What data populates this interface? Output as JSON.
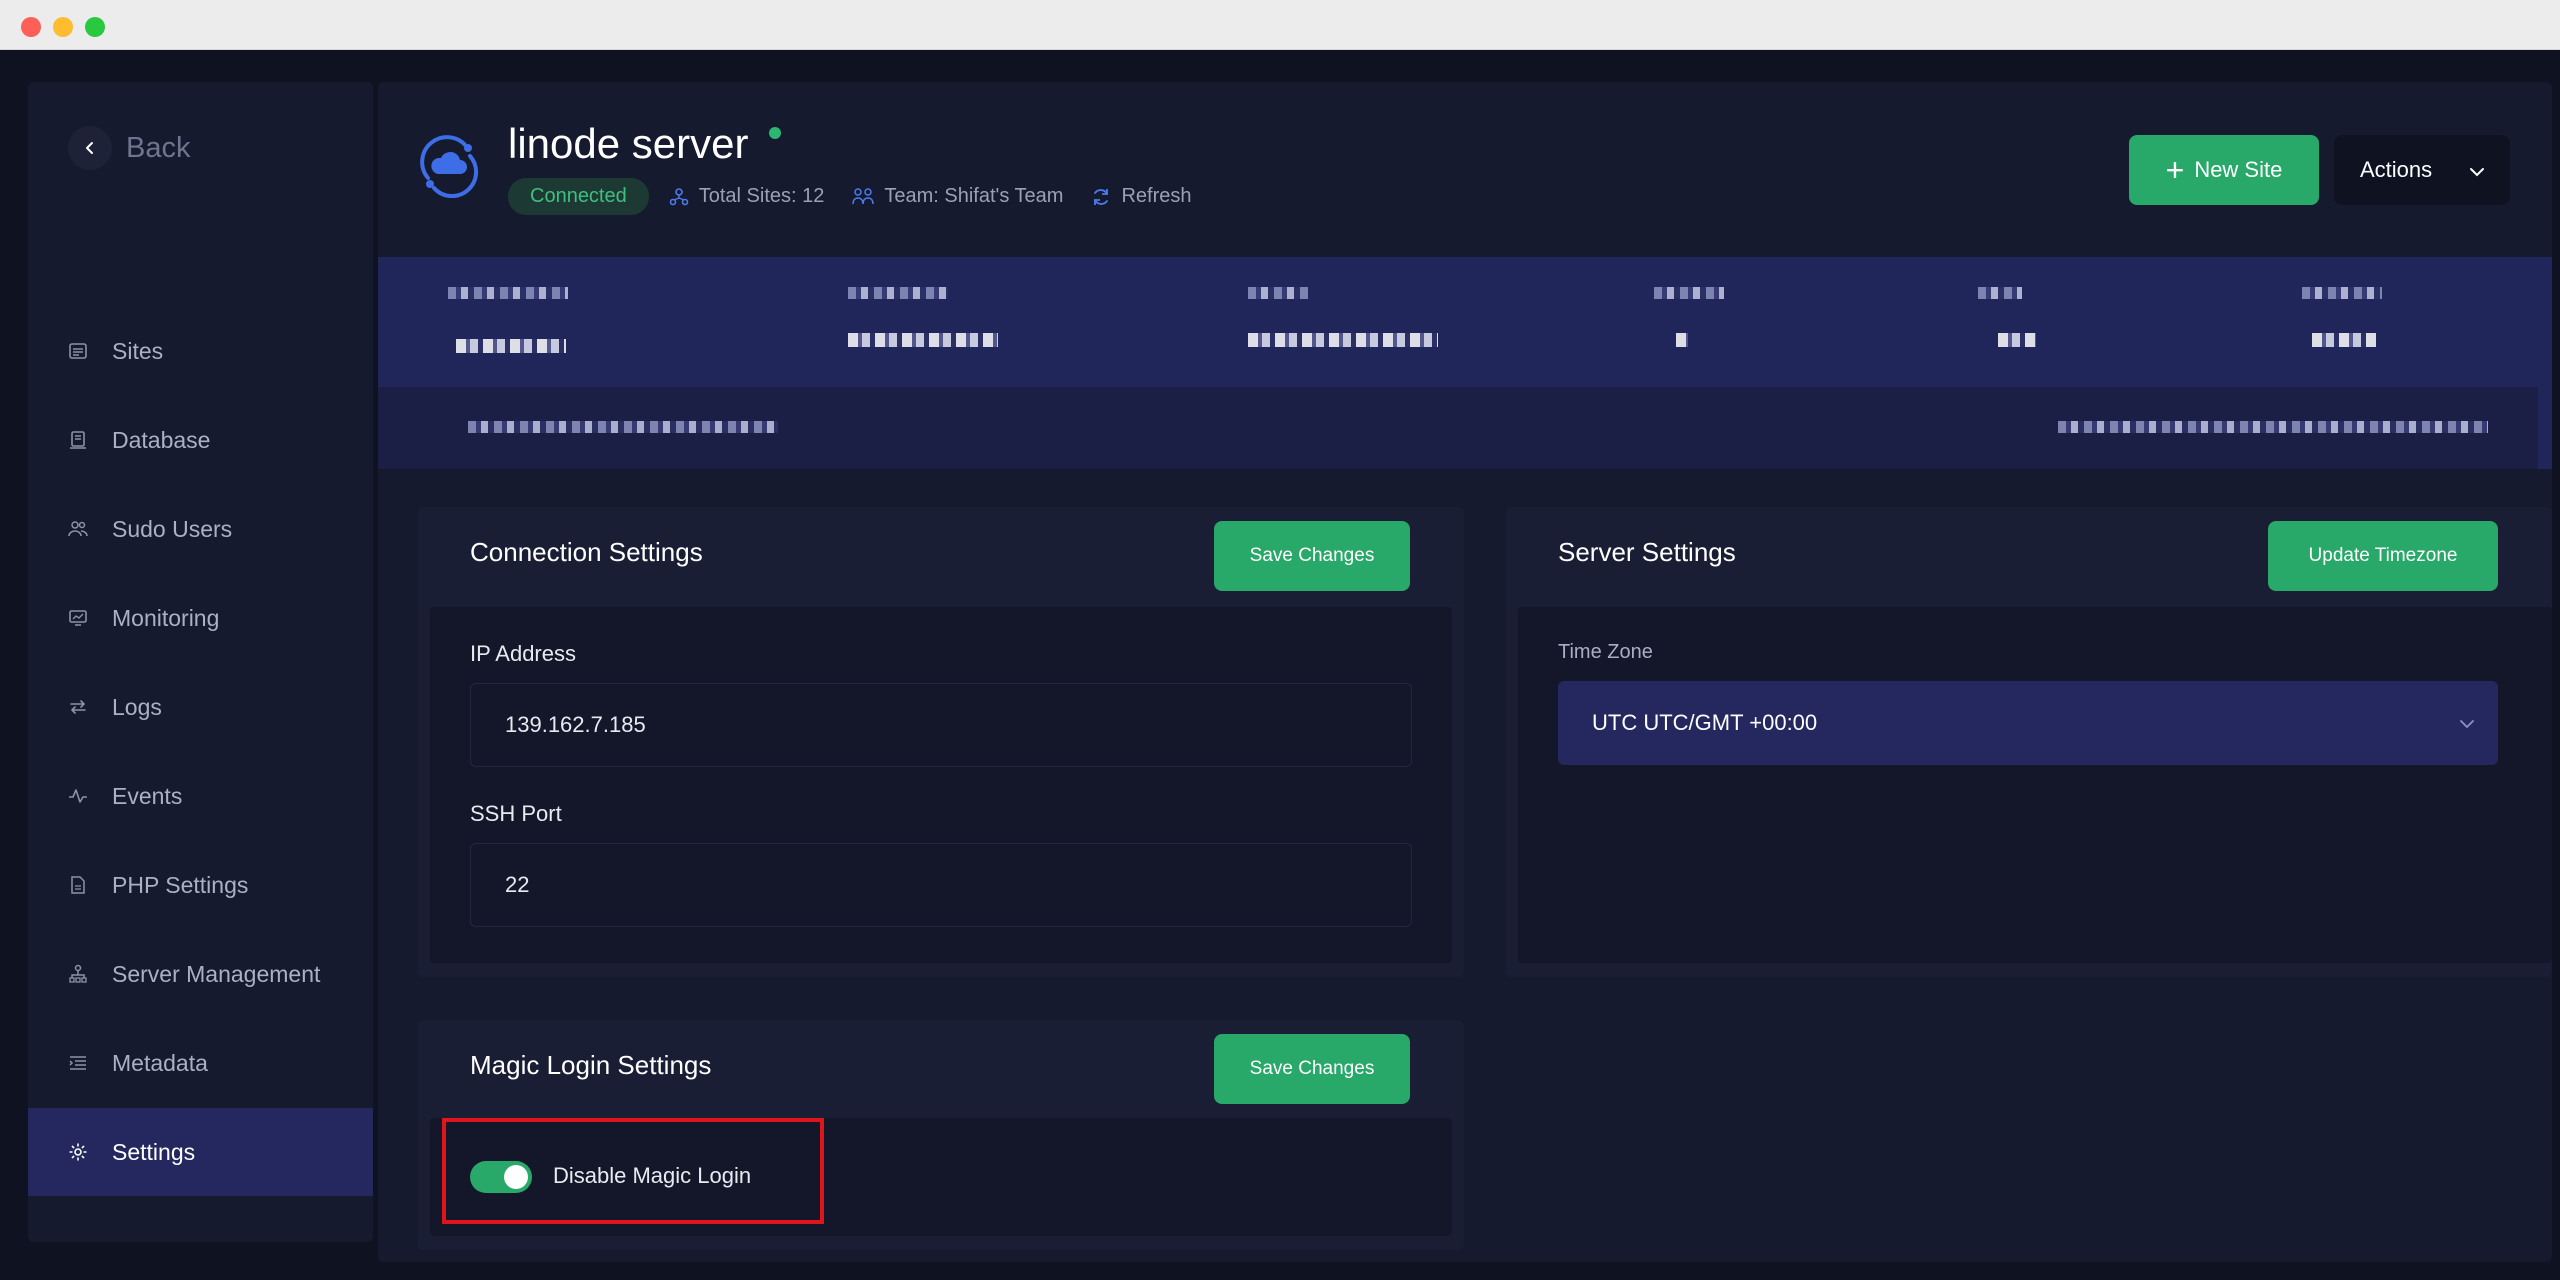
{
  "sidebar": {
    "back_label": "Back",
    "items": [
      {
        "label": "Sites",
        "icon": "sites-icon"
      },
      {
        "label": "Database",
        "icon": "database-icon"
      },
      {
        "label": "Sudo Users",
        "icon": "users-icon"
      },
      {
        "label": "Monitoring",
        "icon": "monitor-icon"
      },
      {
        "label": "Logs",
        "icon": "logs-icon"
      },
      {
        "label": "Events",
        "icon": "activity-icon"
      },
      {
        "label": "PHP Settings",
        "icon": "php-icon"
      },
      {
        "label": "Server Management",
        "icon": "server-tree-icon"
      },
      {
        "label": "Metadata",
        "icon": "metadata-icon"
      },
      {
        "label": "Settings",
        "icon": "gear-icon"
      }
    ],
    "active_item": "Settings"
  },
  "header": {
    "server_name": "linode server",
    "status": "Connected",
    "total_sites": "Total Sites: 12",
    "team": "Team: Shifat's Team",
    "refresh": "Refresh",
    "new_site_label": "New Site",
    "actions_label": "Actions"
  },
  "connection_settings": {
    "title": "Connection Settings",
    "save_label": "Save Changes",
    "ip_label": "IP Address",
    "ip_value": "139.162.7.185",
    "ssh_label": "SSH Port",
    "ssh_value": "22"
  },
  "server_settings": {
    "title": "Server Settings",
    "update_label": "Update Timezone",
    "timezone_label": "Time Zone",
    "timezone_value": "UTC UTC/GMT +00:00"
  },
  "magic_login": {
    "title": "Magic Login Settings",
    "save_label": "Save Changes",
    "toggle_label": "Disable Magic Login",
    "toggle_on": true
  },
  "colors": {
    "accent_green": "#28a869",
    "active_nav": "#24285e",
    "highlight": "#e0141b"
  }
}
